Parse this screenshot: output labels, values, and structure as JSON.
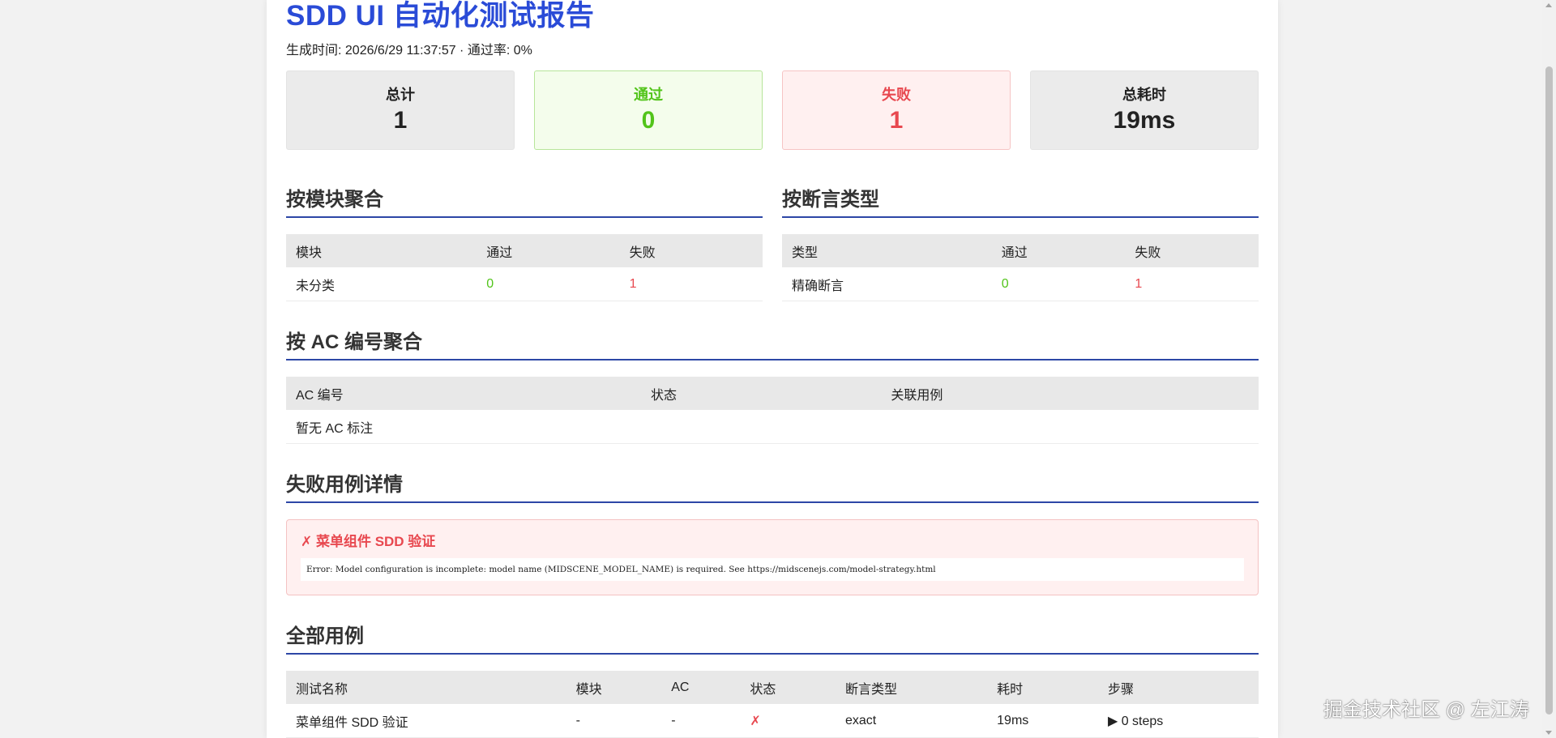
{
  "report": {
    "title": "SDD UI 自动化测试报告",
    "meta": "生成时间: 2026/6/29 11:37:57 · 通过率: 0%"
  },
  "summary": {
    "total_label": "总计",
    "total_value": "1",
    "pass_label": "通过",
    "pass_value": "0",
    "fail_label": "失败",
    "fail_value": "1",
    "duration_label": "总耗时",
    "duration_value": "19ms"
  },
  "by_module": {
    "heading": "按模块聚合",
    "headers": [
      "模块",
      "通过",
      "失败"
    ],
    "rows": [
      [
        "未分类",
        "0",
        "1"
      ]
    ]
  },
  "by_assertion": {
    "heading": "按断言类型",
    "headers": [
      "类型",
      "通过",
      "失败"
    ],
    "rows": [
      [
        "精确断言",
        "0",
        "1"
      ]
    ]
  },
  "by_ac": {
    "heading": "按 AC 编号聚合",
    "headers": [
      "AC 编号",
      "状态",
      "关联用例"
    ],
    "empty": "暂无 AC 标注"
  },
  "failures": {
    "heading": "失败用例详情",
    "items": [
      {
        "title": "✗ 菜单组件 SDD 验证",
        "error": "Error: Model configuration is incomplete: model name (MIDSCENE_MODEL_NAME) is required. See https://midscenejs.com/model-strategy.html"
      }
    ]
  },
  "all_cases": {
    "heading": "全部用例",
    "headers": [
      "测试名称",
      "模块",
      "AC",
      "状态",
      "断言类型",
      "耗时",
      "步骤"
    ],
    "rows": [
      [
        "菜单组件 SDD 验证",
        "-",
        "-",
        "✗",
        "exact",
        "19ms",
        "▶ 0 steps"
      ]
    ]
  },
  "watermark": "掘金技术社区 @ 左江涛",
  "colors": {
    "title": "#2a4bd7",
    "pass": "#52c41a",
    "fail": "#e8484f",
    "heading_rule": "#2d47a6"
  }
}
